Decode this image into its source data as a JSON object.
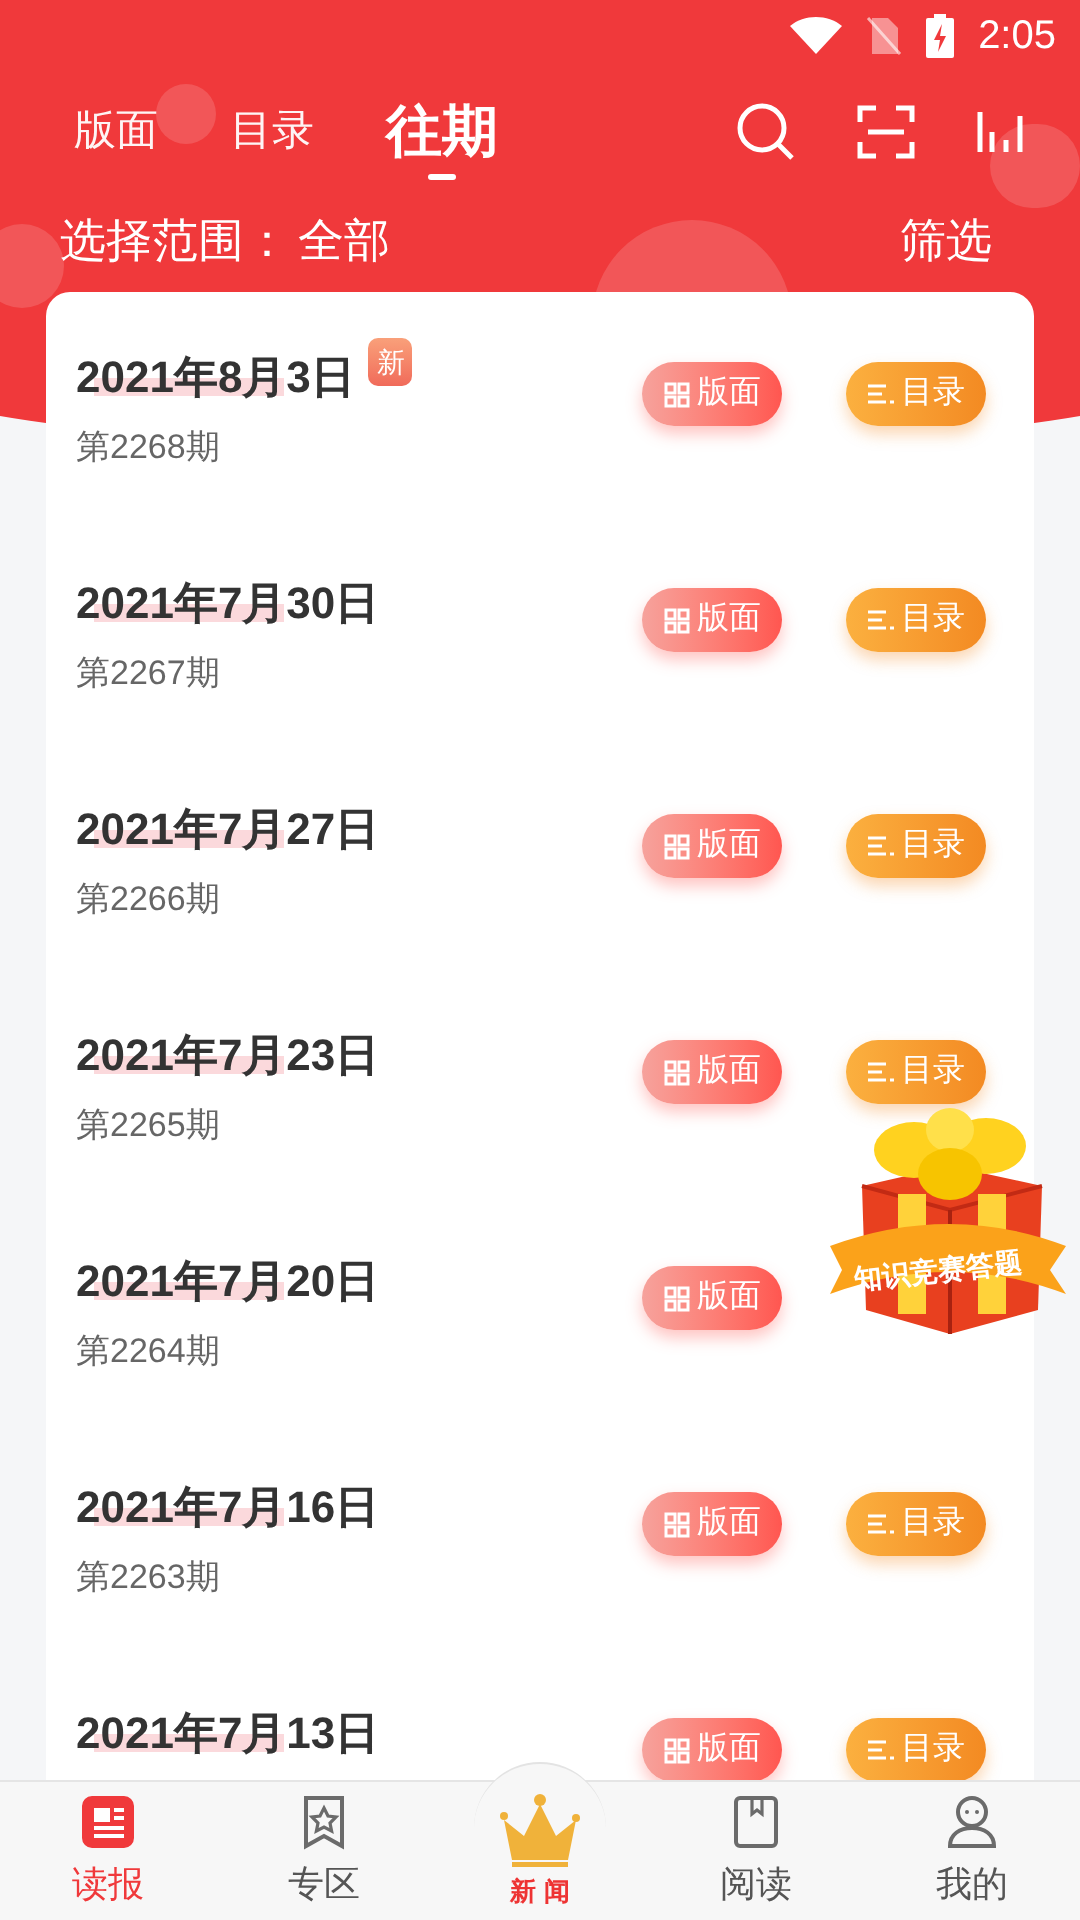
{
  "status_bar": {
    "time": "2:05"
  },
  "tabs": [
    {
      "label": "版面",
      "selected": false
    },
    {
      "label": "目录",
      "selected": false
    },
    {
      "label": "往期",
      "selected": true
    }
  ],
  "filter": {
    "label": "选择范围：",
    "value": "全部",
    "action": "筛选"
  },
  "issues": [
    {
      "date": "2021年8月3日",
      "badge": "新",
      "issue": "第2268期",
      "layout_button": "版面",
      "catalog_button": "目录"
    },
    {
      "date": "2021年7月30日",
      "issue": "第2267期",
      "layout_button": "版面",
      "catalog_button": "目录"
    },
    {
      "date": "2021年7月27日",
      "issue": "第2266期",
      "layout_button": "版面",
      "catalog_button": "目录"
    },
    {
      "date": "2021年7月23日",
      "issue": "第2265期",
      "layout_button": "版面",
      "catalog_button": "目录"
    },
    {
      "date": "2021年7月20日",
      "issue": "第2264期",
      "layout_button": "版面"
    },
    {
      "date": "2021年7月16日",
      "issue": "第2263期",
      "layout_button": "版面",
      "catalog_button": "目录"
    },
    {
      "date": "2021年7月13日",
      "layout_button": "版面",
      "catalog_button": "目录"
    }
  ],
  "promo": {
    "label": "知识竞赛答题"
  },
  "bottom_nav": [
    {
      "label": "读报",
      "kind": "tab",
      "selected": true
    },
    {
      "label": "专区",
      "kind": "tab",
      "selected": false
    },
    {
      "label": "新 闻",
      "kind": "center",
      "selected": false
    },
    {
      "label": "阅读",
      "kind": "tab",
      "selected": false
    },
    {
      "label": "我的",
      "kind": "tab",
      "selected": false
    }
  ]
}
